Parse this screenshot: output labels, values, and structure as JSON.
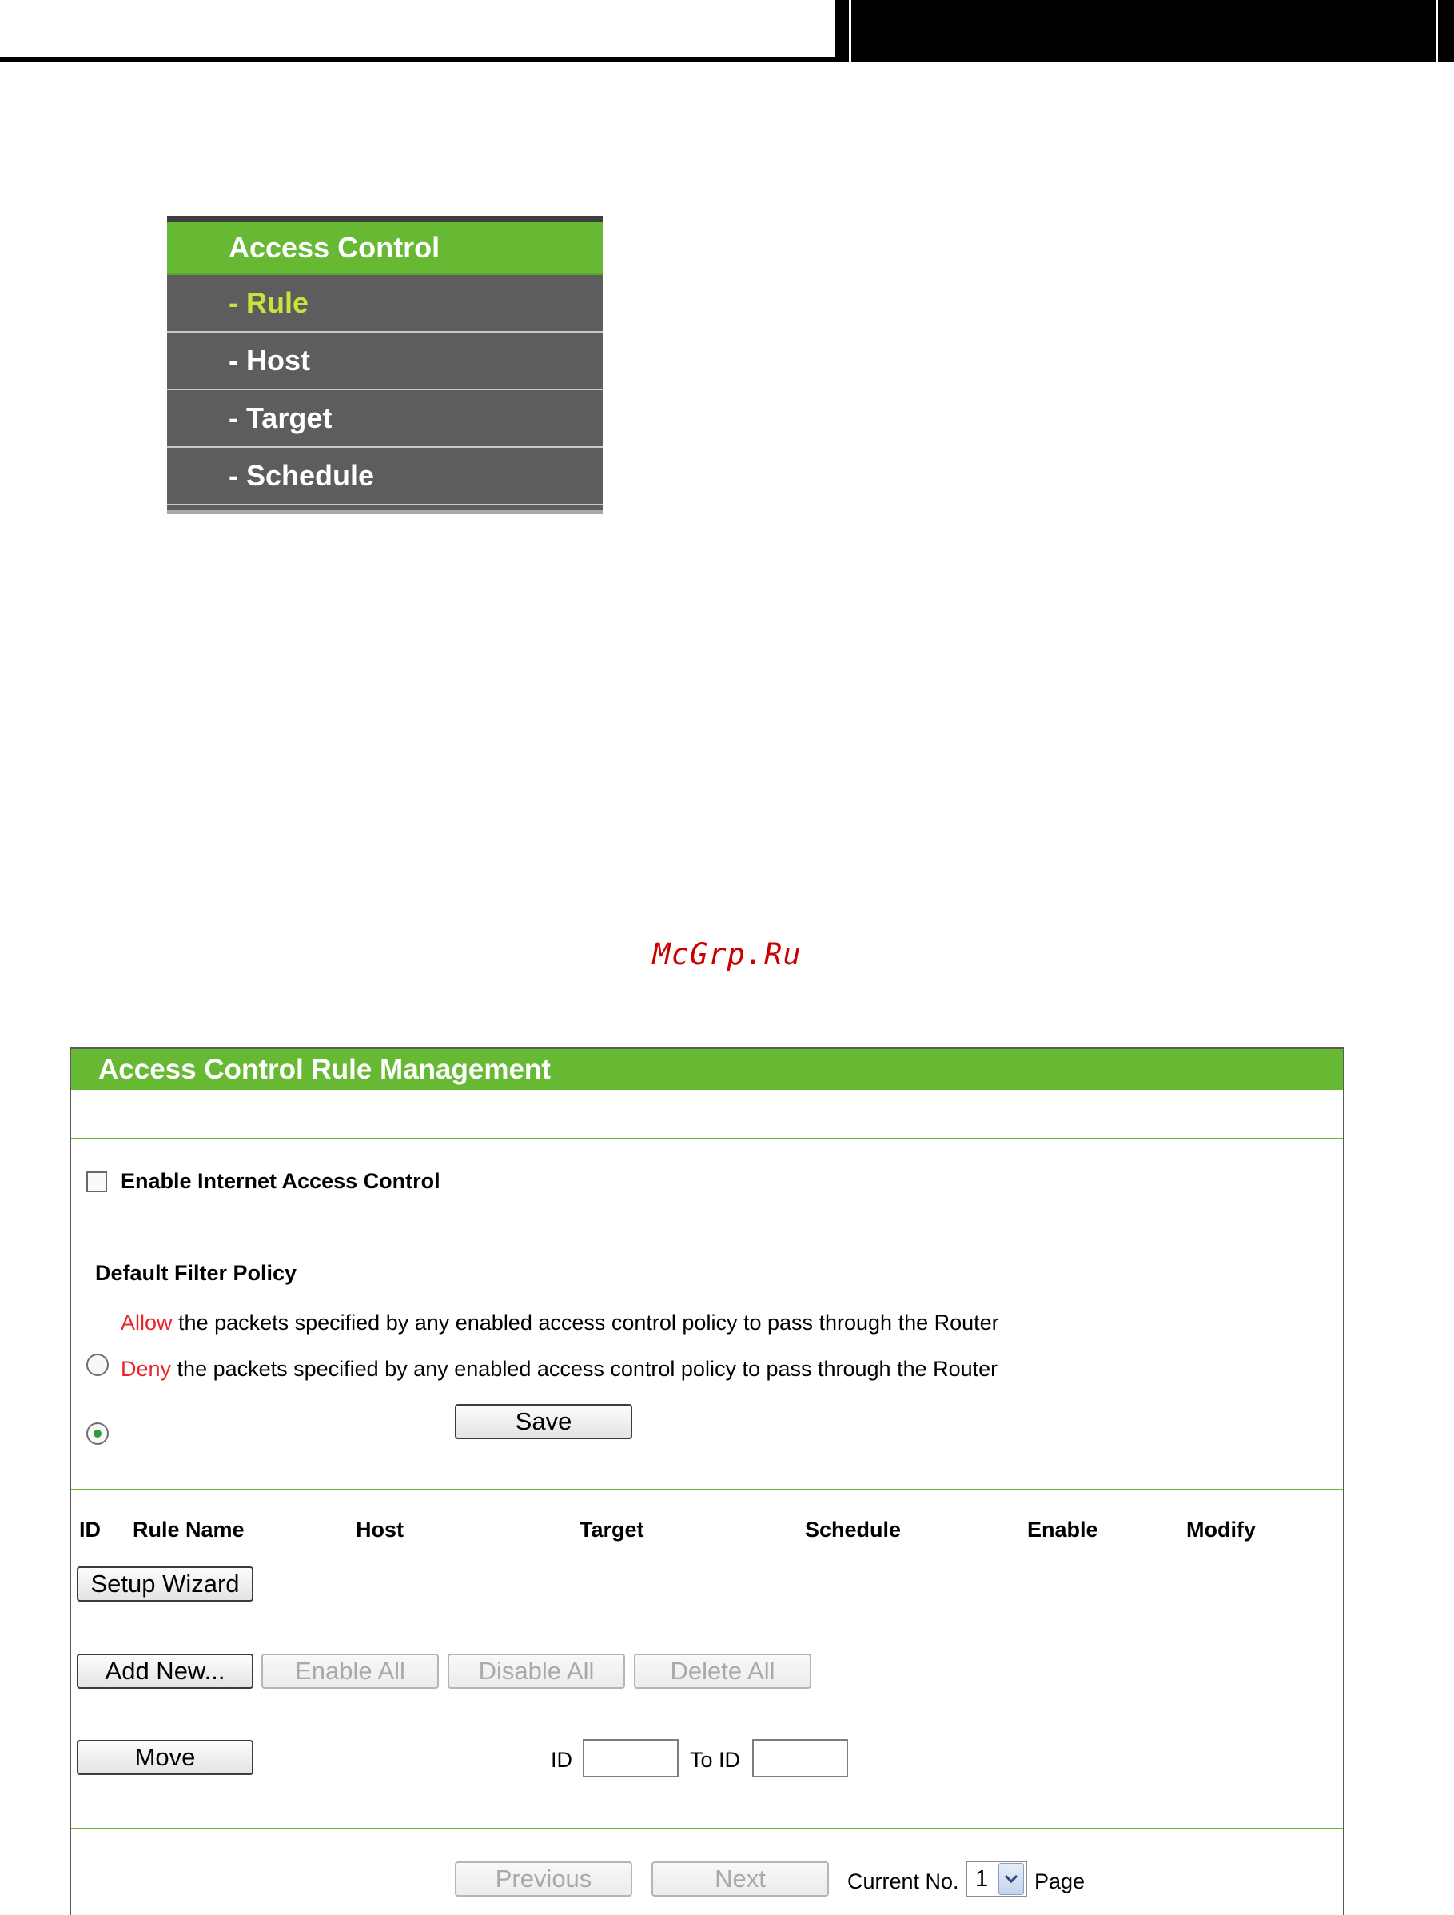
{
  "menu": {
    "header": "Access Control",
    "items": [
      {
        "label": "- Rule",
        "active": true
      },
      {
        "label": "- Host",
        "active": false
      },
      {
        "label": "- Target",
        "active": false
      },
      {
        "label": "- Schedule",
        "active": false
      }
    ]
  },
  "watermark": "McGrp.Ru",
  "panel": {
    "title": "Access Control Rule Management",
    "enable_checkbox_label": "Enable Internet Access Control",
    "enable_checked": false,
    "policy_heading": "Default Filter Policy",
    "policy_options": [
      {
        "keyword": "Allow",
        "rest": "the packets specified by any enabled access control policy to pass through the Router",
        "checked": false
      },
      {
        "keyword": "Deny",
        "rest": "the packets specified by any enabled access control policy to pass through the Router",
        "checked": true
      }
    ],
    "save_label": "Save",
    "columns": [
      "ID",
      "Rule Name",
      "Host",
      "Target",
      "Schedule",
      "Enable",
      "Modify"
    ],
    "setup_wizard_label": "Setup Wizard",
    "add_new_label": "Add New...",
    "enable_all_label": "Enable All",
    "disable_all_label": "Disable All",
    "delete_all_label": "Delete All",
    "move_label": "Move",
    "id_label": "ID",
    "to_id_label": "To ID",
    "id_value": "",
    "to_id_value": "",
    "previous_label": "Previous",
    "next_label": "Next",
    "current_no_label": "Current No.",
    "current_page": "1",
    "page_label": "Page"
  },
  "colors": {
    "accent_green": "#67b832",
    "menu_gray": "#5d5d5d",
    "active_menu_text": "#c4e53a",
    "keyword_red": "#e8232a"
  }
}
